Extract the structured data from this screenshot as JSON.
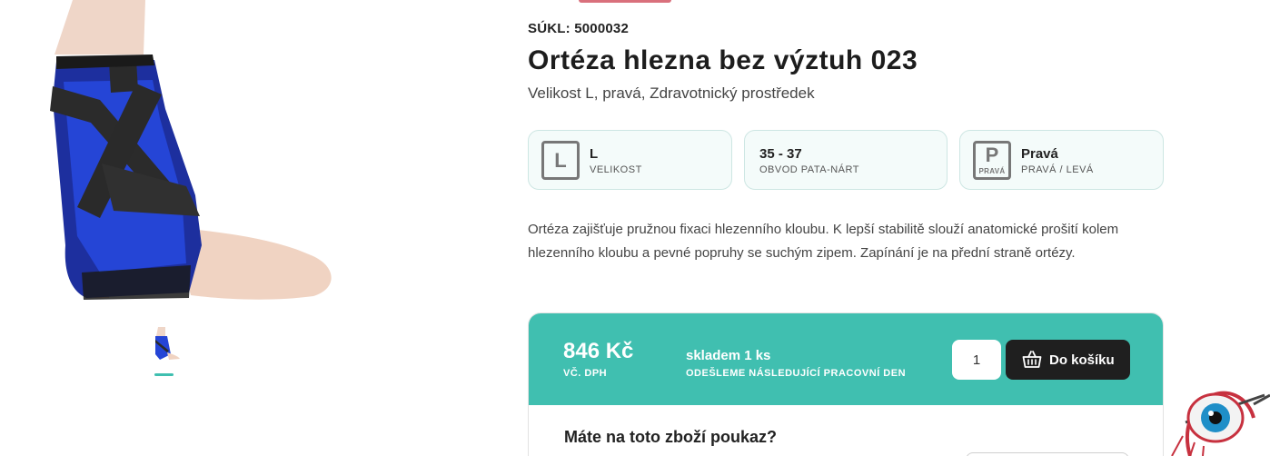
{
  "product": {
    "sukl": "SÚKL: 5000032",
    "title": "Ortéza hlezna bez výztuh 023",
    "subtitle": "Velikost L, pravá, Zdravotnický prostředek",
    "description": "Ortéza zajišťuje pružnou fixaci hlezenního kloubu. K lepší stabilitě slouží anatomické prošití kolem hlezenního kloubu a pevné popruhy se suchým zipem. Zapínání je na přední straně ortézy."
  },
  "params": [
    {
      "icon": "size-letter-icon",
      "icon_text": "L",
      "value": "L",
      "label": "VELIKOST"
    },
    {
      "icon": "",
      "icon_text": "",
      "value": "35 - 37",
      "label": "OBVOD PATA-NÁRT"
    },
    {
      "icon": "side-letter-icon",
      "icon_text": "P",
      "icon_subtext": "PRAVÁ",
      "value": "Pravá",
      "label": "PRAVÁ / LEVÁ"
    }
  ],
  "buy": {
    "price": "846 Kč",
    "vat_note": "VČ. DPH",
    "stock": "skladem 1 ks",
    "shipping": "ODEŠLEME NÁSLEDUJÍCÍ PRACOVNÍ DEN",
    "quantity": "1",
    "cart_label": "Do košíku",
    "cart_icon": "basket-icon"
  },
  "voucher": {
    "title": "Máte na toto zboží poukaz?"
  },
  "colors": {
    "accent": "#40bfb0",
    "dark_button": "#1f1f1f",
    "top_bar": "#d9707c",
    "param_bg": "#f4fbfa",
    "param_border": "#cde6e3"
  }
}
